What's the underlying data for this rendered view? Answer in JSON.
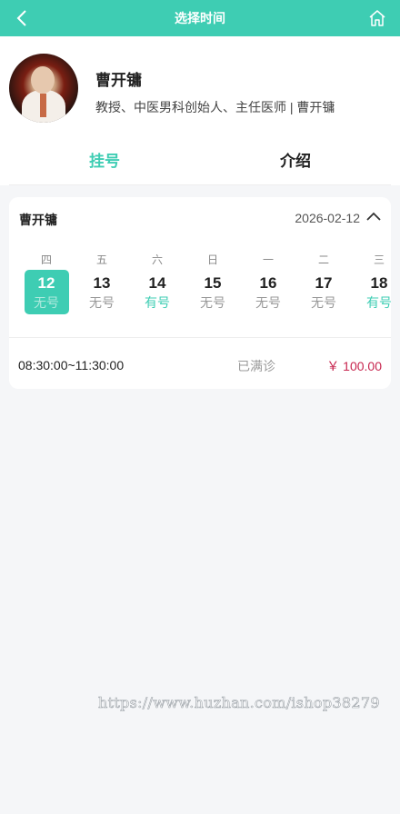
{
  "header": {
    "title": "选择时间",
    "back_icon": "chevron-left-icon",
    "home_icon": "home-icon",
    "color": "#3ecdb3"
  },
  "doctor": {
    "name": "曹开镛",
    "description": "教授、中医男科创始人、主任医师 | 曹开镛"
  },
  "tabs": [
    {
      "label": "挂号",
      "active": true
    },
    {
      "label": "介绍",
      "active": false
    }
  ],
  "schedule": {
    "doctor_name": "曹开镛",
    "date": "2026-02-12",
    "days": [
      {
        "weekday": "四",
        "day": "12",
        "status": "无号",
        "selected": true
      },
      {
        "weekday": "五",
        "day": "13",
        "status": "无号",
        "selected": false
      },
      {
        "weekday": "六",
        "day": "14",
        "status": "有号",
        "selected": false
      },
      {
        "weekday": "日",
        "day": "15",
        "status": "无号",
        "selected": false
      },
      {
        "weekday": "一",
        "day": "16",
        "status": "无号",
        "selected": false
      },
      {
        "weekday": "二",
        "day": "17",
        "status": "无号",
        "selected": false
      },
      {
        "weekday": "三",
        "day": "18",
        "status": "有号",
        "selected": false
      }
    ],
    "slot": {
      "time": "08:30:00~11:30:00",
      "status": "已满诊",
      "price": "￥ 100.00"
    }
  },
  "watermark": "https://www.huzhan.com/ishop38279"
}
